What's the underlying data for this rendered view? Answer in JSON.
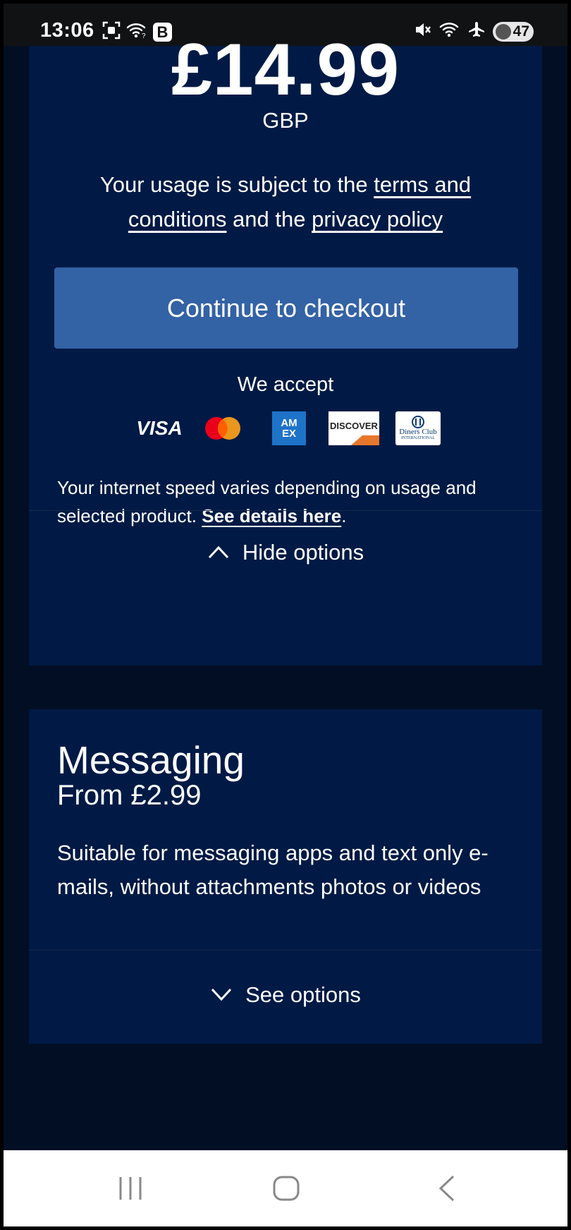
{
  "status_bar": {
    "time": "13:06",
    "badge": "B",
    "battery": "47",
    "icons": [
      "screenshot-icon",
      "wifi-icon",
      "mute-icon",
      "wifi-icon",
      "airplane-icon",
      "battery-icon"
    ]
  },
  "plan": {
    "price": "£14.99",
    "currency": "GBP",
    "terms_pre": "Your usage is subject to the ",
    "terms_link": "terms and conditions",
    "terms_mid": " and the ",
    "privacy_link": "privacy policy",
    "checkout_label": "Continue to checkout",
    "accept_label": "We accept",
    "payment_methods": {
      "visa": "VISA",
      "mastercard": "Mastercard",
      "amex_top": "AM",
      "amex_bottom": "EX",
      "discover": "DISCOVER",
      "diners_top": "Diners Club",
      "diners_bottom": "INTERNATIONAL"
    },
    "speed_text": "Your internet speed varies depending on usage and selected product. ",
    "speed_link": "See details here",
    "speed_end": ".",
    "toggle_label": "Hide options"
  },
  "messaging": {
    "title": "Messaging",
    "from": "From £2.99",
    "description": "Suitable for messaging apps and text only e-mails, without attachments photos or videos",
    "toggle_label": "See options"
  },
  "colors": {
    "background": "#020e24",
    "card": "#001a45",
    "button": "#3362a5"
  }
}
